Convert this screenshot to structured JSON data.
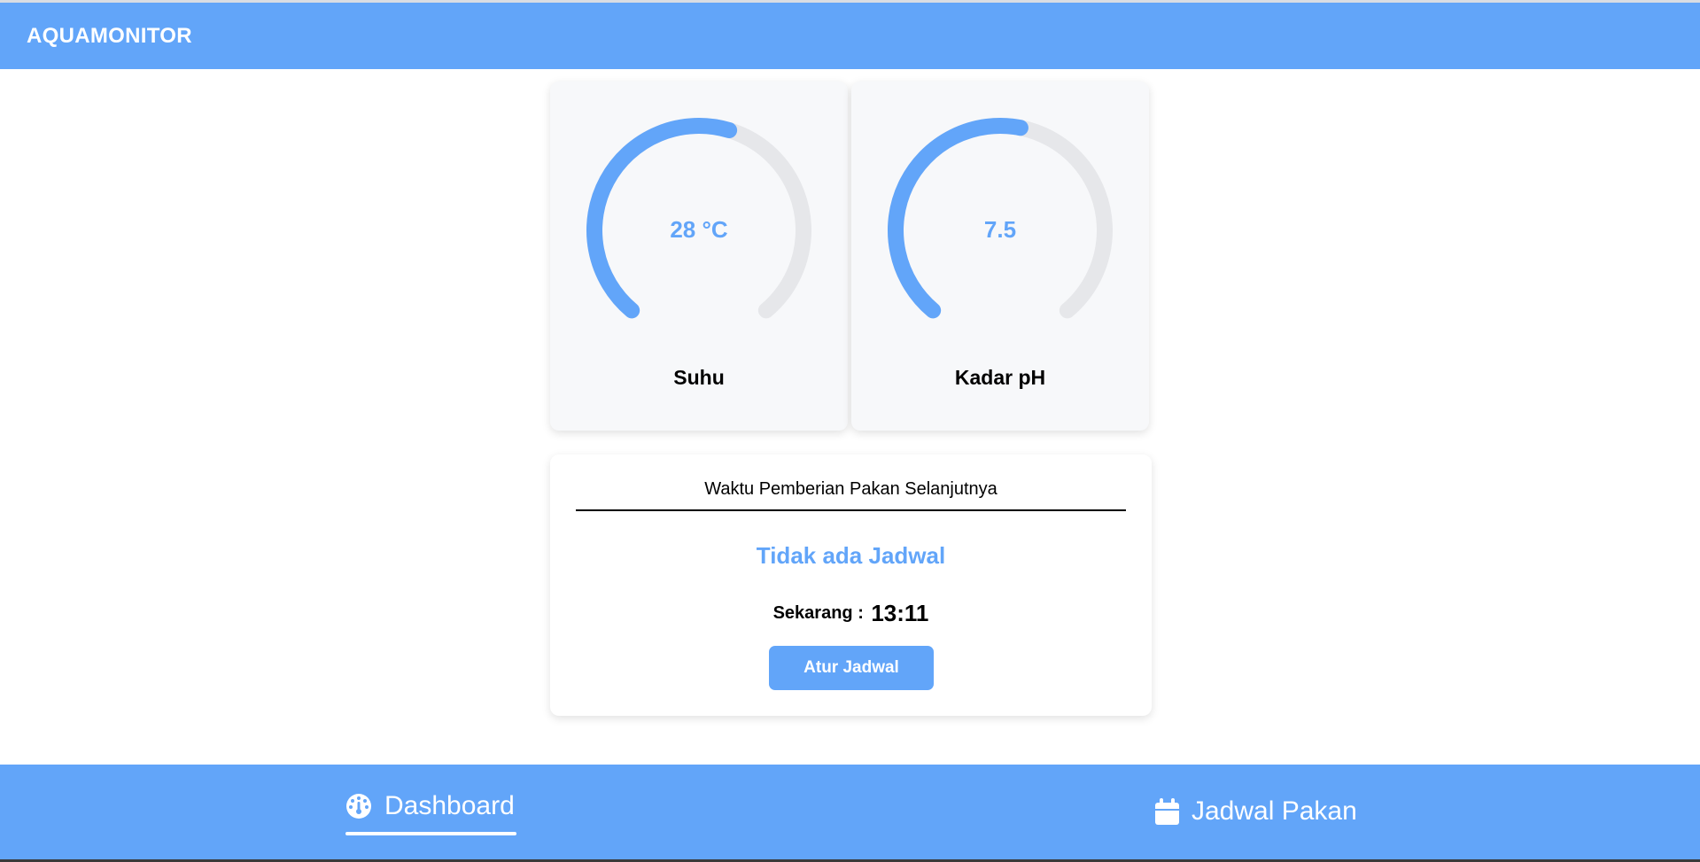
{
  "app": {
    "title": "AQUAMONITOR"
  },
  "colors": {
    "primary": "#62a5f9",
    "track": "#e6e7ea",
    "card_bg": "#f7f8fa"
  },
  "gauges": [
    {
      "label": "Suhu",
      "display": "28 °C",
      "fraction": 0.56
    },
    {
      "label": "Kadar pH",
      "display": "7.5",
      "fraction": 0.54
    }
  ],
  "feed": {
    "title": "Waktu Pemberian Pakan Selanjutnya",
    "status": "Tidak ada Jadwal",
    "now_label": "Sekarang :",
    "now_time": "13:11",
    "button_label": "Atur Jadwal"
  },
  "nav": {
    "items": [
      {
        "label": "Dashboard",
        "icon": "dashboard-icon",
        "active": true
      },
      {
        "label": "Jadwal Pakan",
        "icon": "calendar-icon",
        "active": false
      }
    ]
  }
}
